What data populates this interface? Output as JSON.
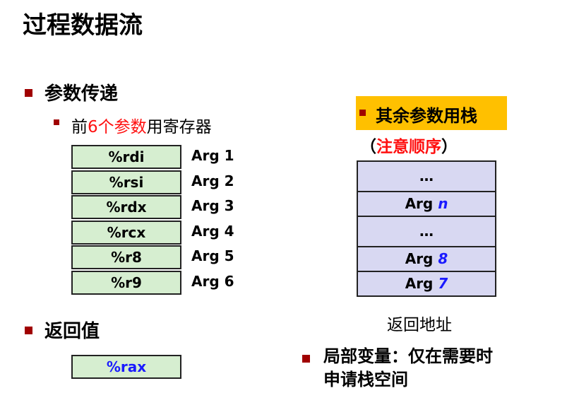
{
  "title": "过程数据流",
  "section1": {
    "heading": "参数传递",
    "sub_prefix": "前",
    "sub_red": "6个参数",
    "sub_suffix": "用寄存器",
    "registers": [
      {
        "reg": "%rdi",
        "arg": "Arg 1"
      },
      {
        "reg": "%rsi",
        "arg": "Arg 2"
      },
      {
        "reg": "%rdx",
        "arg": "Arg 3"
      },
      {
        "reg": "%rcx",
        "arg": "Arg 4"
      },
      {
        "reg": "%r8",
        "arg": "Arg 5"
      },
      {
        "reg": "%r9",
        "arg": "Arg 6"
      }
    ]
  },
  "section2": {
    "heading": "返回值",
    "register": "%rax"
  },
  "stack": {
    "heading": "其余参数用栈",
    "note_open": "（",
    "note_red": "注意顺序",
    "note_close": "）",
    "cells": [
      {
        "label": "…",
        "num": ""
      },
      {
        "label": "Arg ",
        "num": "n"
      },
      {
        "label": "…",
        "num": ""
      },
      {
        "label": "Arg ",
        "num": "8"
      },
      {
        "label": "Arg ",
        "num": "7"
      }
    ],
    "footer": "返回地址"
  },
  "locals": {
    "line1": "局部变量：仅在需要时",
    "line2": "申请栈空间"
  },
  "colors": {
    "bullet": "#a00000",
    "register_fill": "#d6eed0",
    "stack_fill": "#d8d8f2",
    "highlight": "#ffc000",
    "red": "#ff1010",
    "blue": "#1a1aff"
  }
}
